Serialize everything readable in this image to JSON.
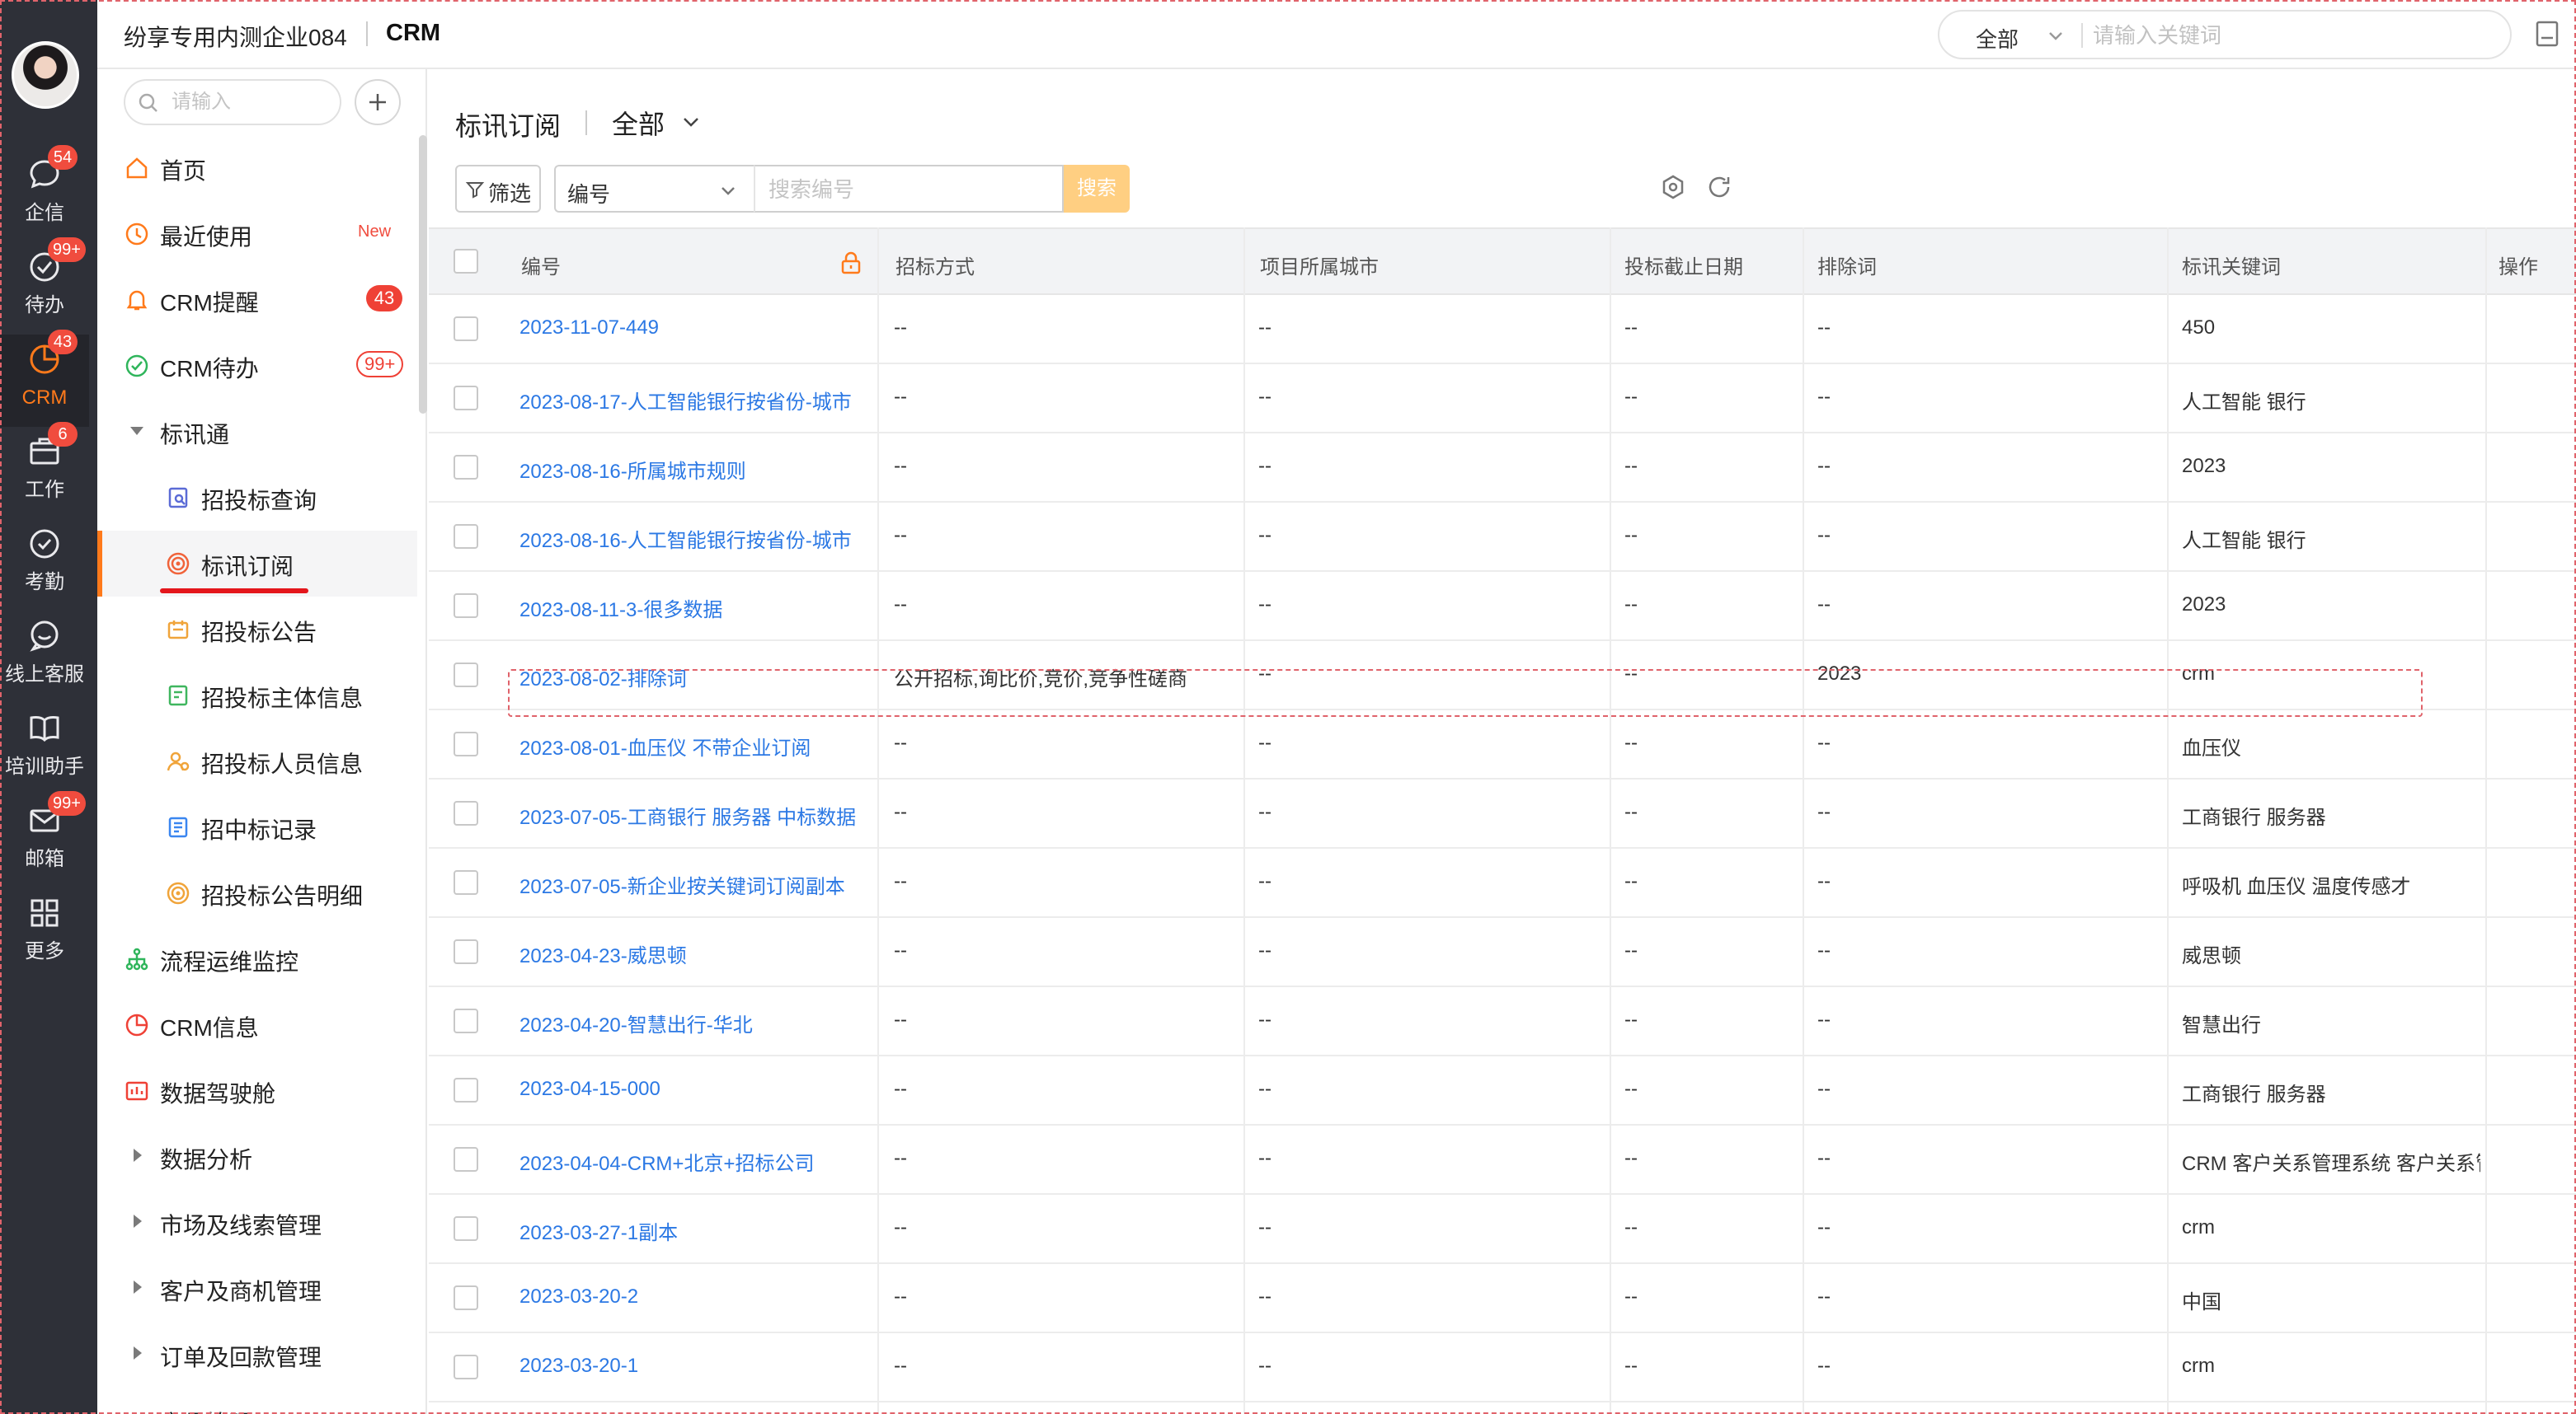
{
  "header": {
    "org_name": "纷享专用内测企业084",
    "app_name": "CRM",
    "search_scope": "全部",
    "search_placeholder": "请输入关键词"
  },
  "rail": [
    {
      "label": "企信",
      "badge": "54",
      "icon": "chat-icon"
    },
    {
      "label": "待办",
      "badge": "99+",
      "icon": "check-circle-icon"
    },
    {
      "label": "CRM",
      "badge": "43",
      "icon": "pie-chart-icon",
      "active": true
    },
    {
      "label": "工作",
      "badge": "6",
      "icon": "briefcase-icon"
    },
    {
      "label": "考勤",
      "badge": "",
      "icon": "shield-check-icon"
    },
    {
      "label": "线上客服",
      "badge": "",
      "icon": "support-chat-icon"
    },
    {
      "label": "培训助手",
      "badge": "",
      "icon": "book-icon"
    },
    {
      "label": "邮箱",
      "badge": "99+",
      "icon": "mail-icon"
    },
    {
      "label": "更多",
      "badge": "",
      "icon": "grid-icon"
    }
  ],
  "nav": {
    "search_placeholder": "请输入",
    "items": [
      {
        "label": "首页",
        "icon": "home-icon"
      },
      {
        "label": "最近使用",
        "icon": "clock-icon",
        "tag": "New"
      },
      {
        "label": "CRM提醒",
        "icon": "bell-icon",
        "badge": "43"
      },
      {
        "label": "CRM待办",
        "icon": "check-circle-icon",
        "badge": "99+"
      },
      {
        "label": "标讯通",
        "icon": "caret-down-icon"
      },
      {
        "label": "招投标查询",
        "icon": "search-doc-icon"
      },
      {
        "label": "标讯订阅",
        "icon": "subscribe-target-icon",
        "active": true
      },
      {
        "label": "招投标公告",
        "icon": "announcement-icon"
      },
      {
        "label": "招投标主体信息",
        "icon": "entity-info-icon"
      },
      {
        "label": "招投标人员信息",
        "icon": "person-info-icon"
      },
      {
        "label": "招中标记录",
        "icon": "record-icon"
      },
      {
        "label": "招投标公告明细",
        "icon": "detail-target-icon"
      },
      {
        "label": "流程运维监控",
        "icon": "flow-icon"
      },
      {
        "label": "CRM信息",
        "icon": "pie-chart-icon"
      },
      {
        "label": "数据驾驶舱",
        "icon": "dashboard-icon"
      },
      {
        "label": "数据分析",
        "icon": "caret-right-icon"
      },
      {
        "label": "市场及线索管理",
        "icon": "caret-right-icon"
      },
      {
        "label": "客户及商机管理",
        "icon": "caret-right-icon"
      },
      {
        "label": "订单及回款管理",
        "icon": "caret-right-icon"
      },
      {
        "label": "产品管理",
        "icon": "caret-right-icon"
      }
    ]
  },
  "main": {
    "title": "标讯订阅",
    "scope": "全部",
    "filter_label": "筛选",
    "field_select": "编号",
    "search_placeholder": "搜索编号",
    "search_button": "搜索"
  },
  "table": {
    "columns": [
      "编号",
      "招标方式",
      "项目所属城市",
      "投标截止日期",
      "排除词",
      "标讯关键词",
      "操作"
    ],
    "rows": [
      {
        "id": "2023-11-07-449",
        "method": "--",
        "city": "--",
        "deadline": "--",
        "exclude": "--",
        "keywords": "450"
      },
      {
        "id": "2023-08-17-人工智能银行按省份-城市",
        "method": "--",
        "city": "--",
        "deadline": "--",
        "exclude": "--",
        "keywords": "人工智能 银行"
      },
      {
        "id": "2023-08-16-所属城市规则",
        "method": "--",
        "city": "--",
        "deadline": "--",
        "exclude": "--",
        "keywords": "2023"
      },
      {
        "id": "2023-08-16-人工智能银行按省份-城市",
        "method": "--",
        "city": "--",
        "deadline": "--",
        "exclude": "--",
        "keywords": "人工智能 银行"
      },
      {
        "id": "2023-08-11-3-很多数据",
        "method": "--",
        "city": "--",
        "deadline": "--",
        "exclude": "--",
        "keywords": "2023"
      },
      {
        "id": "2023-08-02-排除词",
        "method": "公开招标,询比价,竞价,竞争性磋商",
        "city": "--",
        "deadline": "--",
        "exclude": "2023",
        "keywords": "crm"
      },
      {
        "id": "2023-08-01-血压仪 不带企业订阅",
        "method": "--",
        "city": "--",
        "deadline": "--",
        "exclude": "--",
        "keywords": "血压仪"
      },
      {
        "id": "2023-07-05-工商银行 服务器 中标数据",
        "method": "--",
        "city": "--",
        "deadline": "--",
        "exclude": "--",
        "keywords": "工商银行 服务器"
      },
      {
        "id": "2023-07-05-新企业按关键词订阅副本",
        "method": "--",
        "city": "--",
        "deadline": "--",
        "exclude": "--",
        "keywords": "呼吸机 血压仪 温度传感才"
      },
      {
        "id": "2023-04-23-威思顿",
        "method": "--",
        "city": "--",
        "deadline": "--",
        "exclude": "--",
        "keywords": "威思顿"
      },
      {
        "id": "2023-04-20-智慧出行-华北",
        "method": "--",
        "city": "--",
        "deadline": "--",
        "exclude": "--",
        "keywords": "智慧出行"
      },
      {
        "id": "2023-04-15-000",
        "method": "--",
        "city": "--",
        "deadline": "--",
        "exclude": "--",
        "keywords": "工商银行 服务器"
      },
      {
        "id": "2023-04-04-CRM+北京+招标公司",
        "method": "--",
        "city": "--",
        "deadline": "--",
        "exclude": "--",
        "keywords": "CRM 客户关系管理系统 客户关系管"
      },
      {
        "id": "2023-03-27-1副本",
        "method": "--",
        "city": "--",
        "deadline": "--",
        "exclude": "--",
        "keywords": "crm"
      },
      {
        "id": "2023-03-20-2",
        "method": "--",
        "city": "--",
        "deadline": "--",
        "exclude": "--",
        "keywords": "中国"
      },
      {
        "id": "2023-03-20-1",
        "method": "--",
        "city": "--",
        "deadline": "--",
        "exclude": "--",
        "keywords": "crm"
      }
    ]
  },
  "colors": {
    "rail_bg": "#2e3038",
    "accent": "#ff7a1b",
    "link": "#2b78e4",
    "badge_red": "#f04c3e",
    "search_button_bg": "#ffcf82"
  }
}
